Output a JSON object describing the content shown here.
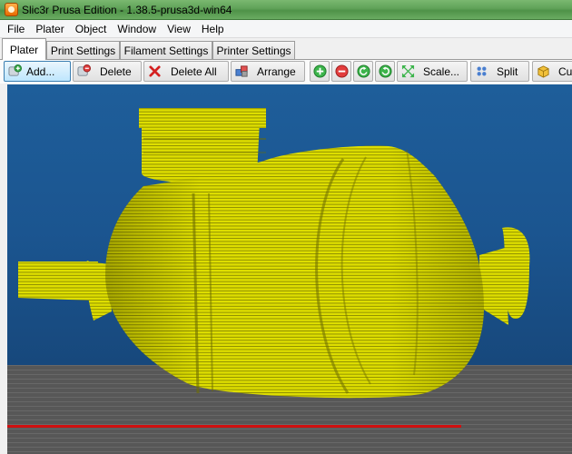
{
  "window": {
    "title": "Slic3r Prusa Edition - 1.38.5-prusa3d-win64",
    "accent_color": "#5fa258"
  },
  "menu": {
    "items": [
      "File",
      "Plater",
      "Object",
      "Window",
      "View",
      "Help"
    ]
  },
  "tabs": {
    "items": [
      "Plater",
      "Print Settings",
      "Filament Settings",
      "Printer Settings"
    ],
    "active": "Plater"
  },
  "toolbar": {
    "add_label": "Add...",
    "delete_label": "Delete",
    "delete_all_label": "Delete All",
    "arrange_label": "Arrange",
    "scale_label": "Scale...",
    "split_label": "Split",
    "cut_label": "Cut",
    "icons": [
      "add-icon",
      "delete-icon",
      "delete-all-icon",
      "arrange-icon",
      "increase-instances-icon",
      "decrease-instances-icon",
      "rotate-ccw-icon",
      "rotate-cw-icon",
      "scale-icon",
      "split-icon",
      "cut-icon"
    ]
  },
  "viewport": {
    "background_color": "#1b5590",
    "bed_color": "#555555",
    "model_color": "#e8e600",
    "axis_color": "#d01010"
  }
}
